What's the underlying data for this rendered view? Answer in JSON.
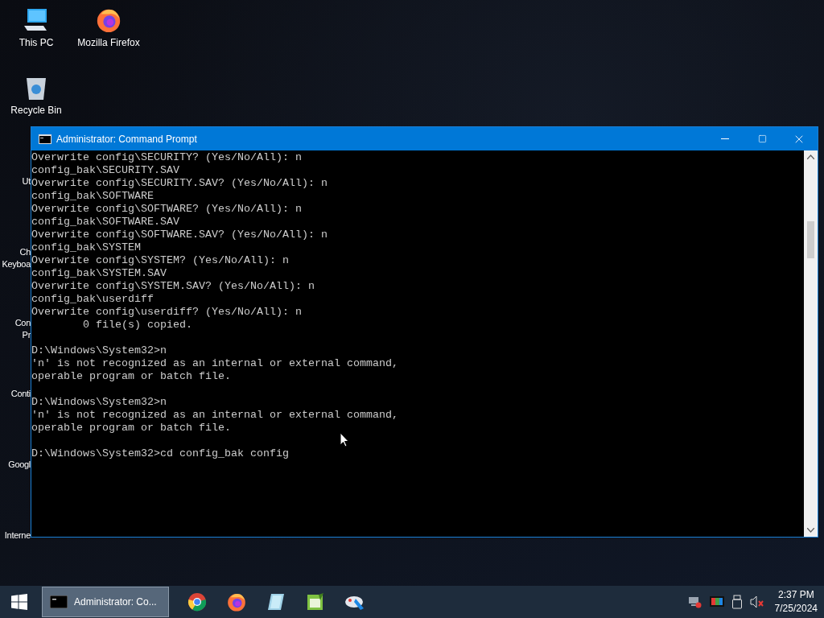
{
  "desktop_icons": [
    {
      "kind": "pc",
      "label": "This PC"
    },
    {
      "kind": "firefox",
      "label": "Mozilla Firefox"
    },
    {
      "kind": "bin",
      "label": "Recycle Bin"
    }
  ],
  "hidden_icon_labels": [
    {
      "lines": [
        "Ut"
      ]
    },
    {
      "lines": [
        "Ch",
        "Keyboa"
      ]
    },
    {
      "lines": [
        "Con",
        "Pr"
      ]
    },
    {
      "lines": [
        "Conti"
      ]
    },
    {
      "lines": [
        "Googl"
      ]
    },
    {
      "lines": [
        "Interne"
      ]
    }
  ],
  "window": {
    "title": "Administrator: Command Prompt",
    "console_blocks": [
      [
        "Overwrite config\\SECURITY? (Yes/No/All): n",
        "config_bak\\SECURITY.SAV",
        "Overwrite config\\SECURITY.SAV? (Yes/No/All): n",
        "config_bak\\SOFTWARE",
        "Overwrite config\\SOFTWARE? (Yes/No/All): n",
        "config_bak\\SOFTWARE.SAV",
        "Overwrite config\\SOFTWARE.SAV? (Yes/No/All): n",
        "config_bak\\SYSTEM",
        "Overwrite config\\SYSTEM? (Yes/No/All): n",
        "config_bak\\SYSTEM.SAV",
        "Overwrite config\\SYSTEM.SAV? (Yes/No/All): n",
        "config_bak\\userdiff",
        "Overwrite config\\userdiff? (Yes/No/All): n",
        "        0 file(s) copied."
      ],
      [
        "D:\\Windows\\System32>n",
        "'n' is not recognized as an internal or external command,",
        "operable program or batch file."
      ],
      [
        "D:\\Windows\\System32>n",
        "'n' is not recognized as an internal or external command,",
        "operable program or batch file."
      ],
      [
        "D:\\Windows\\System32>cd config_bak config"
      ]
    ]
  },
  "taskbar": {
    "active_app": {
      "label": "Administrator: Co..."
    },
    "pinned": [
      {
        "kind": "chrome"
      },
      {
        "kind": "firefox"
      },
      {
        "kind": "notepad"
      },
      {
        "kind": "sheet"
      },
      {
        "kind": "paint"
      }
    ],
    "time": "2:37 PM",
    "date": "7/25/2024"
  }
}
